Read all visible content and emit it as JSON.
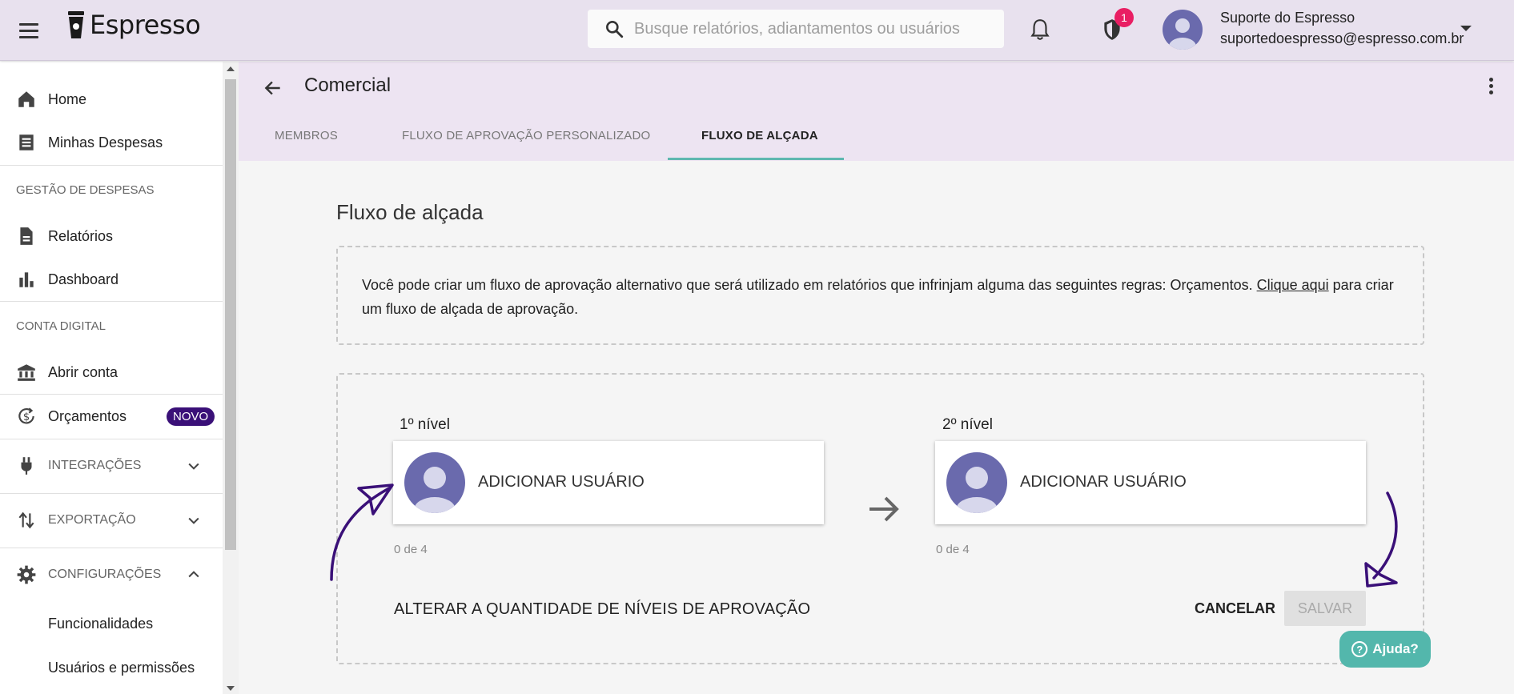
{
  "app": {
    "name": "Espresso",
    "search_placeholder": "Busque relatórios, adiantamentos ou usuários",
    "security_badge_count": "1",
    "user": {
      "name": "Suporte do Espresso",
      "email": "suportedoespresso@espresso.com.br"
    }
  },
  "sidebar": {
    "home": "Home",
    "my_expenses": "Minhas Despesas",
    "section_expense_mgmt": "GESTÃO DE DESPESAS",
    "reports": "Relatórios",
    "dashboard": "Dashboard",
    "section_digital_account": "CONTA DIGITAL",
    "open_account": "Abrir conta",
    "budgets": "Orçamentos",
    "budgets_badge": "NOVO",
    "integrations": "INTEGRAÇÕES",
    "export": "EXPORTAÇÃO",
    "settings": "CONFIGURAÇÕES",
    "features": "Funcionalidades",
    "users_permissions": "Usuários e permissões"
  },
  "page": {
    "title": "Comercial",
    "tabs": [
      {
        "label": "MEMBROS",
        "active": false
      },
      {
        "label": "FLUXO DE APROVAÇÃO PERSONALIZADO",
        "active": false
      },
      {
        "label": "FLUXO DE ALÇADA",
        "active": true
      }
    ],
    "section_title": "Fluxo de alçada",
    "info_text_before": "Você pode criar um fluxo de aprovação alternativo que será utilizado em relatórios que infrinjam alguma das seguintes regras: Orçamentos. ",
    "info_link": "Clique aqui",
    "info_text_after": " para criar um fluxo de alçada de aprovação.",
    "levels": [
      {
        "label": "1º nível",
        "action": "ADICIONAR USUÁRIO",
        "count": "0 de 4"
      },
      {
        "label": "2º nível",
        "action": "ADICIONAR USUÁRIO",
        "count": "0 de 4"
      }
    ],
    "change_levels": "ALTERAR A QUANTIDADE DE NÍVEIS DE APROVAÇÃO",
    "cancel": "CANCELAR",
    "save": "SALVAR",
    "help": "Ajuda?"
  },
  "colors": {
    "topbar": "#e8e1ee",
    "header": "#ede4f2",
    "tab_indicator": "#5fb8b0",
    "badge_novo": "#3a1078",
    "annotation": "#3a1078",
    "help": "#53b7ac"
  }
}
